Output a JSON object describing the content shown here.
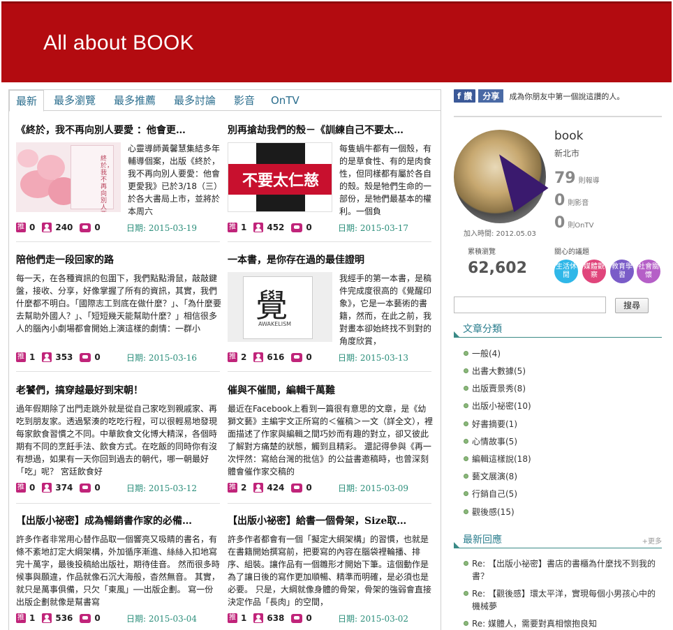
{
  "site": {
    "title": "All about BOOK"
  },
  "tabs": [
    "最新",
    "最多瀏覽",
    "最多推薦",
    "最多討論",
    "影音",
    "OnTV"
  ],
  "posts": [
    {
      "title": "《終於，我不再向別人要愛 ：他會更…",
      "excerpt": "心靈導師黃馨慧集結多年輔導個案，出版《終於，我不再向別人要愛：他會更愛我》已於3/18（三）於各大書局上市，並將於本周六",
      "thumb_text": "終於，我不再向別人要愛",
      "recommend": "0",
      "views": "240",
      "comments": "0",
      "date": "日期: 2015-03-19"
    },
    {
      "title": "別再搶劫我們的殼－《訓練自己不要太…",
      "excerpt": "每隻蝸牛都有一個殼，有的是草食性、有的是肉食性，但同樣都有屬於各自的殼。殼是牠們生命的一部份，是牠們最基本的權利。一個負",
      "thumb_text": "不要太仁慈",
      "recommend": "1",
      "views": "452",
      "comments": "0",
      "date": "日期: 2015-03-17"
    },
    {
      "title": "陪他們走一段回家的路",
      "excerpt": "每一天，在各種資訊的包圍下，我們點點滑鼠，敲敲鍵盤，接收、分享，好像掌握了所有的資訊，其實，我們什麼都不明白。「國際志工到底在做什麼？」、「為什麼要去幫助外國人？」、「短短幾天能幫助什麼？」相信很多人的腦內小劇場都會開始上演這樣的劇情：一群小",
      "recommend": "1",
      "views": "353",
      "comments": "0",
      "date": "日期: 2015-03-16"
    },
    {
      "title": "一本書，是你存在過的最佳證明",
      "excerpt": "我經手的第一本書，是稿件完成度很高的《覺醒印象》，它是一本藝術的書籍，然而，在此之前，我對畫本卻始終找不到對的角度欣賞，",
      "thumb_text": "覺",
      "thumb_caption": "AWAKELISM",
      "recommend": "2",
      "views": "616",
      "comments": "0",
      "date": "日期: 2015-03-13"
    },
    {
      "title": "老饕們，搞穿越最好到宋朝！",
      "excerpt": "過年假期除了出門走跳外就是從自己家吃到親戚家、再吃到朋友家。透過緊湊的吃吃行程，可以很輕易地發現每家飲食習慣之不同。中華飲食文化博大精深，各個時期有不同的烹飪手法、飲食方式。在吃飯的同時你有沒有想過，如果有一天你回到過去的朝代，哪一朝最好「吃」呢？ 宮廷飲食好",
      "recommend": "0",
      "views": "374",
      "comments": "0",
      "date": "日期: 2015-03-12"
    },
    {
      "title": "催與不催間，編輯千萬難",
      "excerpt": "最近在Facebook上看到一篇很有意思的文章，是《幼獅文藝》主編宇文正所寫的＜催稿＞一文（詳全文），裡面描述了作家與編輯之間巧妙而有趣的對立，卻又彼此了解對方痛楚的狀態，觸到且精彩。 還記得參與《再一次怦然：寫給台灣的批信》的公益書邀稿時，也曾深刻體會催作家交稿的",
      "recommend": "2",
      "views": "424",
      "comments": "0",
      "date": "日期: 2015-03-09"
    },
    {
      "title": "【出版小祕密】成為暢銷書作家的必備…",
      "excerpt": "許多作者非常用心替作品取一個響亮又吸睛的書名，有條不紊地訂定大綱架構，外加循序漸進、絲絲入扣地寫完十萬字，最後投稿給出版社，期待佳音。 然而很多時候事與願違，作品就像石沉大海般，杳然無音。 其實，就只是萬事俱備，只欠「東風」──出版企劃。 寫一份出版企劃就像是幫書寫",
      "recommend": "1",
      "views": "536",
      "comments": "0",
      "date": "日期: 2015-03-04"
    },
    {
      "title": "【出版小祕密】給書一個骨架，Size取…",
      "excerpt": "許多作者都會有一個「擬定大綱架構」的習慣，也就是在書籍開始撰寫前，把要寫的內容在腦袋裡輪播、排序、組裝。讓作品有一個雛形才開始下筆。這個動作是為了讓日後的寫作更加順暢、精準而明確，是必須也是必要。 只是，大綱就像身體的骨架，骨架的強弱會直接決定作品「長肉」的空間，",
      "recommend": "1",
      "views": "638",
      "comments": "0",
      "date": "日期: 2015-03-02"
    }
  ],
  "icons": {
    "recommend_glyph": "推"
  },
  "share": {
    "fb_label": "讚",
    "share_label": "分享",
    "message": "成為你朋友中第一個說這讚的人。"
  },
  "profile": {
    "name": "book",
    "city": "新北市",
    "stats": [
      {
        "n": "79",
        "label": "則報導"
      },
      {
        "n": "0",
        "label": "則影音"
      },
      {
        "n": "0",
        "label": "則OnTV"
      }
    ],
    "joined": "加入時間: 2012.05.03",
    "visits_label": "累積瀏覽",
    "visits": "62,602",
    "topics_label": "關心的議題",
    "topics": [
      {
        "label": "生活休閒",
        "color": "#2fb7e8"
      },
      {
        "label": "媒體觀察",
        "color": "#e0457b"
      },
      {
        "label": "教育學習",
        "color": "#7a5cc8"
      },
      {
        "label": "社會關懷",
        "color": "#b55fc7"
      }
    ]
  },
  "search": {
    "button": "搜尋",
    "placeholder": ""
  },
  "categories": {
    "heading": "文章分類",
    "items": [
      "一般(4)",
      "出書大數據(5)",
      "出版賣景秀(8)",
      "出版小祕密(10)",
      "好書摘要(1)",
      "心情故事(5)",
      "編輯這樣說(18)",
      "藝文展演(8)",
      "行銷自己(5)",
      "觀後感(15)"
    ]
  },
  "replies": {
    "heading": "最新回應",
    "more": "+更多",
    "items": [
      "Re: 【出版小祕密】書店的書櫃為什麼找不到我的書？",
      "Re: 【觀後感】環太平洋，實現每個小男孩心中的機械夢",
      "Re: 媒體人，需要對真相懷抱良知"
    ]
  }
}
